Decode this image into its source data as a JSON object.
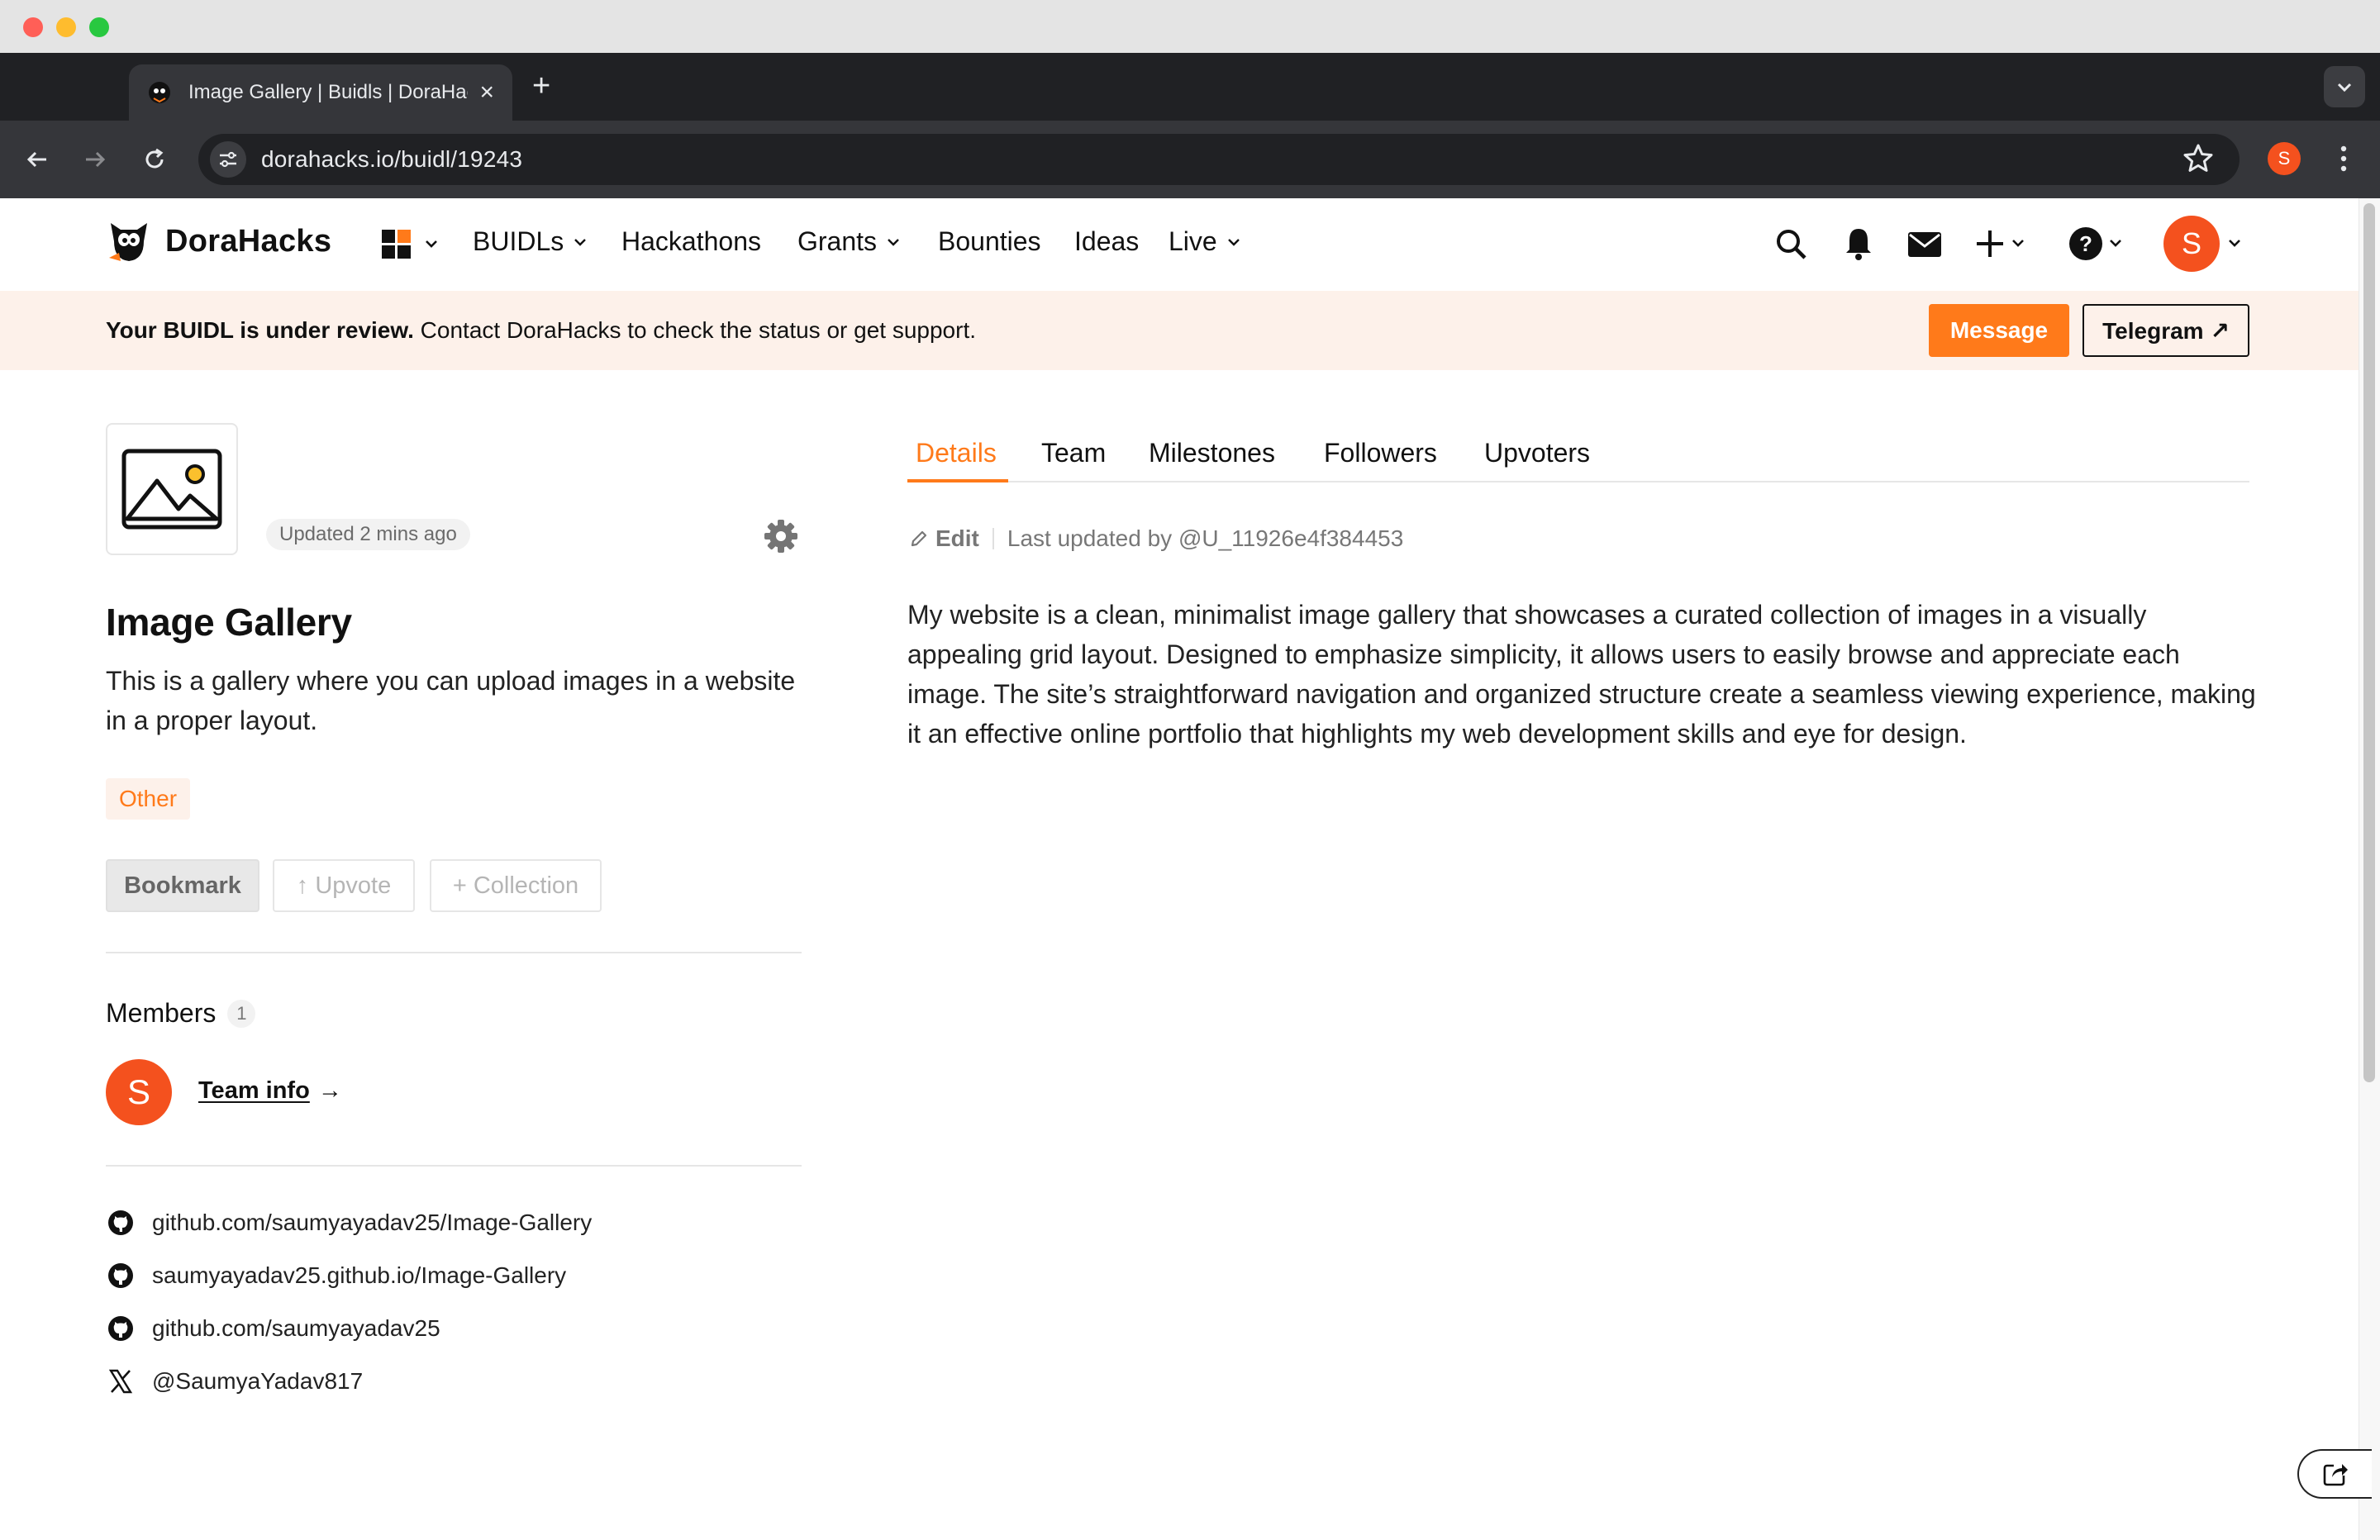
{
  "browser": {
    "tab_title": "Image Gallery | Buidls | DoraHacks",
    "url": "dorahacks.io/buidl/19243",
    "profile_initial": "S"
  },
  "header": {
    "brand": "DoraHacks",
    "nav": [
      {
        "label": "BUIDLs",
        "has_menu": true
      },
      {
        "label": "Hackathons",
        "has_menu": false
      },
      {
        "label": "Grants",
        "has_menu": true
      },
      {
        "label": "Bounties",
        "has_menu": false
      },
      {
        "label": "Ideas",
        "has_menu": false
      },
      {
        "label": "Live",
        "has_menu": true
      }
    ],
    "user_initial": "S"
  },
  "banner": {
    "bold_text": "Your BUIDL is under review.",
    "text": " Contact DoraHacks to check the status or get support.",
    "message_label": "Message",
    "telegram_label": "Telegram ↗"
  },
  "buidl": {
    "updated": "Updated 2 mins ago",
    "title": "Image Gallery",
    "description": "This is a gallery where you can upload images in a website in a proper layout.",
    "tag": "Other",
    "bookmark_label": "Bookmark",
    "upvote_label": "↑ Upvote",
    "collection_label": "+ Collection"
  },
  "members": {
    "title": "Members",
    "count": "1",
    "avatar_initial": "S",
    "team_info_label": "Team info",
    "team_info_arrow": "→"
  },
  "links": [
    {
      "icon": "github-icon",
      "text": "github.com/saumyayadav25/Image-Gallery"
    },
    {
      "icon": "github-icon",
      "text": "saumyayadav25.github.io/Image-Gallery"
    },
    {
      "icon": "github-icon",
      "text": "github.com/saumyayadav25"
    },
    {
      "icon": "x-icon",
      "text": "@SaumyaYadav817"
    }
  ],
  "tabs": [
    "Details",
    "Team",
    "Milestones",
    "Followers",
    "Upvoters"
  ],
  "details": {
    "edit_label": "Edit",
    "last_updated": "Last updated by @U_11926e4f384453",
    "body": "My website is a clean, minimalist image gallery that showcases a curated collection of images in a visually appealing grid layout. Designed to emphasize simplicity, it allows users to easily browse and appreciate each image. The site’s straightforward navigation and organized structure create a seamless viewing experience, making it an effective online portfolio that highlights my web development skills and eye for design."
  },
  "colors": {
    "accent": "#ff7a1a",
    "avatar": "#f4511e",
    "banner_bg": "#fdf1ea"
  }
}
